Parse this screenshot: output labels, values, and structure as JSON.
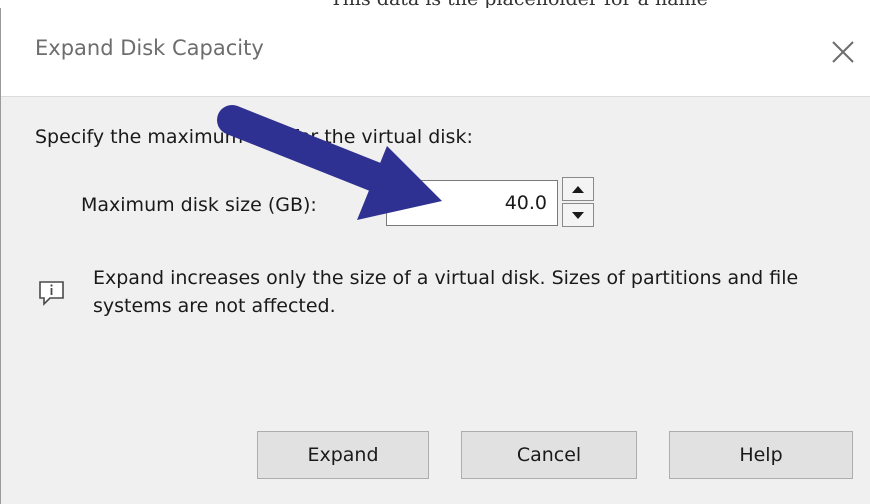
{
  "background_text": "This data is the placeholder for a name",
  "dialog": {
    "title": "Expand Disk Capacity",
    "close_icon": "close-icon",
    "prompt": "Specify the maximum size for the virtual disk:",
    "size_label": "Maximum disk size (GB):",
    "size_value": "40.0",
    "spinner_up_icon": "spin-up-arrow-icon",
    "spinner_down_icon": "spin-down-arrow-icon",
    "info_icon": "info-comment-icon",
    "info_text": "Expand increases only the size of a virtual disk. Sizes of partitions and file systems are not affected.",
    "buttons": {
      "expand": "Expand",
      "cancel": "Cancel",
      "help": "Help"
    }
  },
  "annotation": {
    "arrow_icon": "pointer-arrow-icon",
    "arrow_color": "#2e3192"
  }
}
